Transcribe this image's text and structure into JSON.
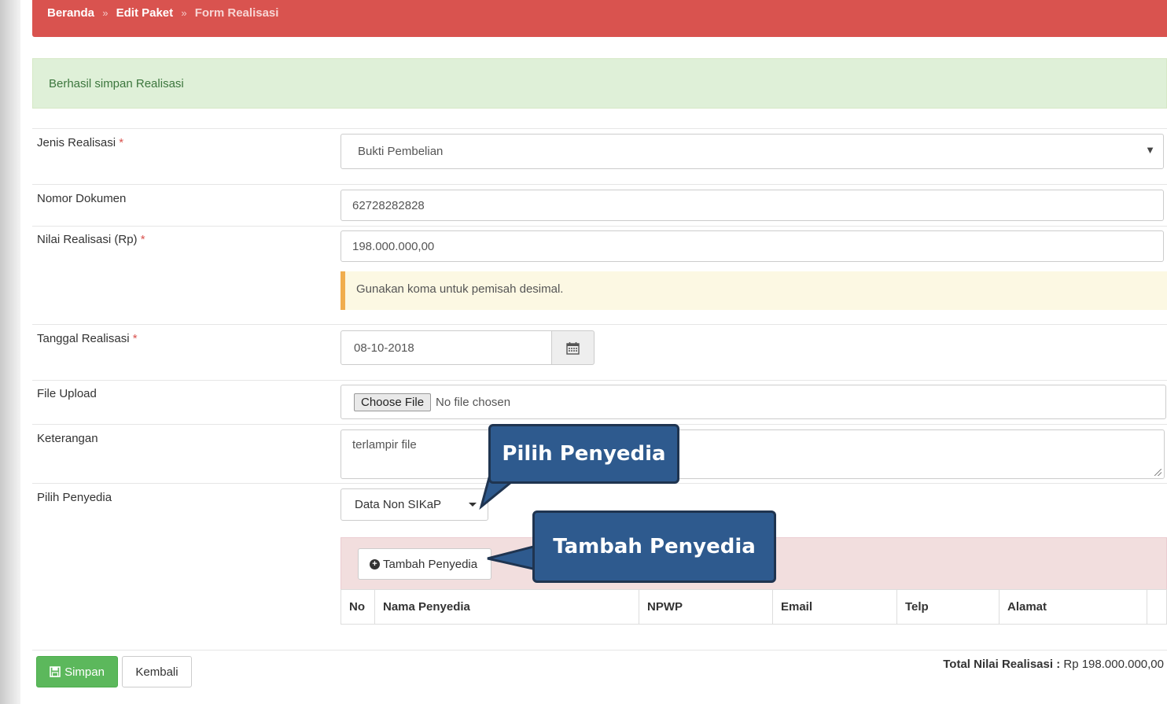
{
  "breadcrumb": {
    "home": "Beranda",
    "sep1": "»",
    "edit": "Edit Paket",
    "sep2": "»",
    "current": "Form Realisasi"
  },
  "alert": {
    "message": "Berhasil simpan Realisasi"
  },
  "form": {
    "required_mark": "*",
    "jenis": {
      "label": "Jenis Realisasi",
      "value": "Bukti Pembelian",
      "arrow": "▼"
    },
    "nomor": {
      "label": "Nomor Dokumen",
      "value": "62728282828"
    },
    "nilai": {
      "label": "Nilai Realisasi (Rp)",
      "value": "198.000.000,00",
      "hint": "Gunakan koma untuk pemisah desimal."
    },
    "tanggal": {
      "label": "Tanggal Realisasi",
      "value": "08-10-2018",
      "icon": "calendar-icon"
    },
    "file": {
      "label": "File Upload",
      "button": "Choose File",
      "status": "No file chosen"
    },
    "keterangan": {
      "label": "Keterangan",
      "value": "terlampir file"
    },
    "penyedia": {
      "label": "Pilih Penyedia",
      "selected": "Data Non SIKaP"
    }
  },
  "penyedia_panel": {
    "add_button": "Tambah Penyedia",
    "add_icon": "plus-circle-icon",
    "columns": [
      "No",
      "Nama Penyedia",
      "NPWP",
      "Email",
      "Telp",
      "Alamat"
    ]
  },
  "callouts": {
    "pilih": "Pilih Penyedia",
    "tambah": "Tambah Penyedia"
  },
  "footer": {
    "simpan": "Simpan",
    "simpan_icon": "save-icon",
    "kembali": "Kembali",
    "total_label": "Total Nilai Realisasi :",
    "total_value": "Rp 198.000.000,00"
  },
  "colors": {
    "breadcrumb_bg": "#d9534f",
    "success_bg": "#dff0d8",
    "warning_bg": "#fcf8e3",
    "danger_bg": "#f2dede",
    "callout_bg": "#2e5a8e",
    "simpan_bg": "#5cb85c"
  }
}
